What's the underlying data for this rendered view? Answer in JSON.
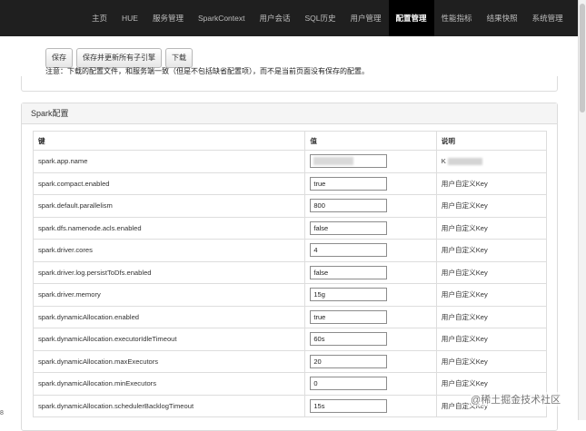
{
  "nav": {
    "items": [
      {
        "label": "主页",
        "active": false
      },
      {
        "label": "HUE",
        "active": false
      },
      {
        "label": "服务管理",
        "active": false
      },
      {
        "label": "SparkContext",
        "active": false
      },
      {
        "label": "用户会话",
        "active": false
      },
      {
        "label": "SQL历史",
        "active": false
      },
      {
        "label": "用户管理",
        "active": false
      },
      {
        "label": "配置管理",
        "active": true
      },
      {
        "label": "性能指标",
        "active": false
      },
      {
        "label": "结果快照",
        "active": false
      },
      {
        "label": "系统管理",
        "active": false
      }
    ]
  },
  "toolbar": {
    "save_label": "保存",
    "save_refresh_label": "保存并更新所有子引擎",
    "download_label": "下载"
  },
  "notice": "注意：下载的配置文件，和服务端一致（但是不包括缺省配置项），而不是当前页面没有保存的配置。",
  "spark_panel": {
    "title": "Spark配置",
    "columns": {
      "key": "键",
      "value": "值",
      "desc": "说明"
    },
    "rows": [
      {
        "key": "spark.app.name",
        "value": "",
        "desc": "K"
      },
      {
        "key": "spark.compact.enabled",
        "value": "true",
        "desc": "用户自定义Key"
      },
      {
        "key": "spark.default.parallelism",
        "value": "800",
        "desc": "用户自定义Key"
      },
      {
        "key": "spark.dfs.namenode.acls.enabled",
        "value": "false",
        "desc": "用户自定义Key"
      },
      {
        "key": "spark.driver.cores",
        "value": "4",
        "desc": "用户自定义Key"
      },
      {
        "key": "spark.driver.log.persistToDfs.enabled",
        "value": "false",
        "desc": "用户自定义Key"
      },
      {
        "key": "spark.driver.memory",
        "value": "15g",
        "desc": "用户自定义Key"
      },
      {
        "key": "spark.dynamicAllocation.enabled",
        "value": "true",
        "desc": "用户自定义Key"
      },
      {
        "key": "spark.dynamicAllocation.executorIdleTimeout",
        "value": "60s",
        "desc": "用户自定义Key"
      },
      {
        "key": "spark.dynamicAllocation.maxExecutors",
        "value": "20",
        "desc": "用户自定义Key"
      },
      {
        "key": "spark.dynamicAllocation.minExecutors",
        "value": "0",
        "desc": "用户自定义Key"
      },
      {
        "key": "spark.dynamicAllocation.schedulerBacklogTimeout",
        "value": "15s",
        "desc": "用户自定义Key"
      }
    ]
  },
  "watermark": "@稀土掘金技术社区",
  "left_marker": "8"
}
